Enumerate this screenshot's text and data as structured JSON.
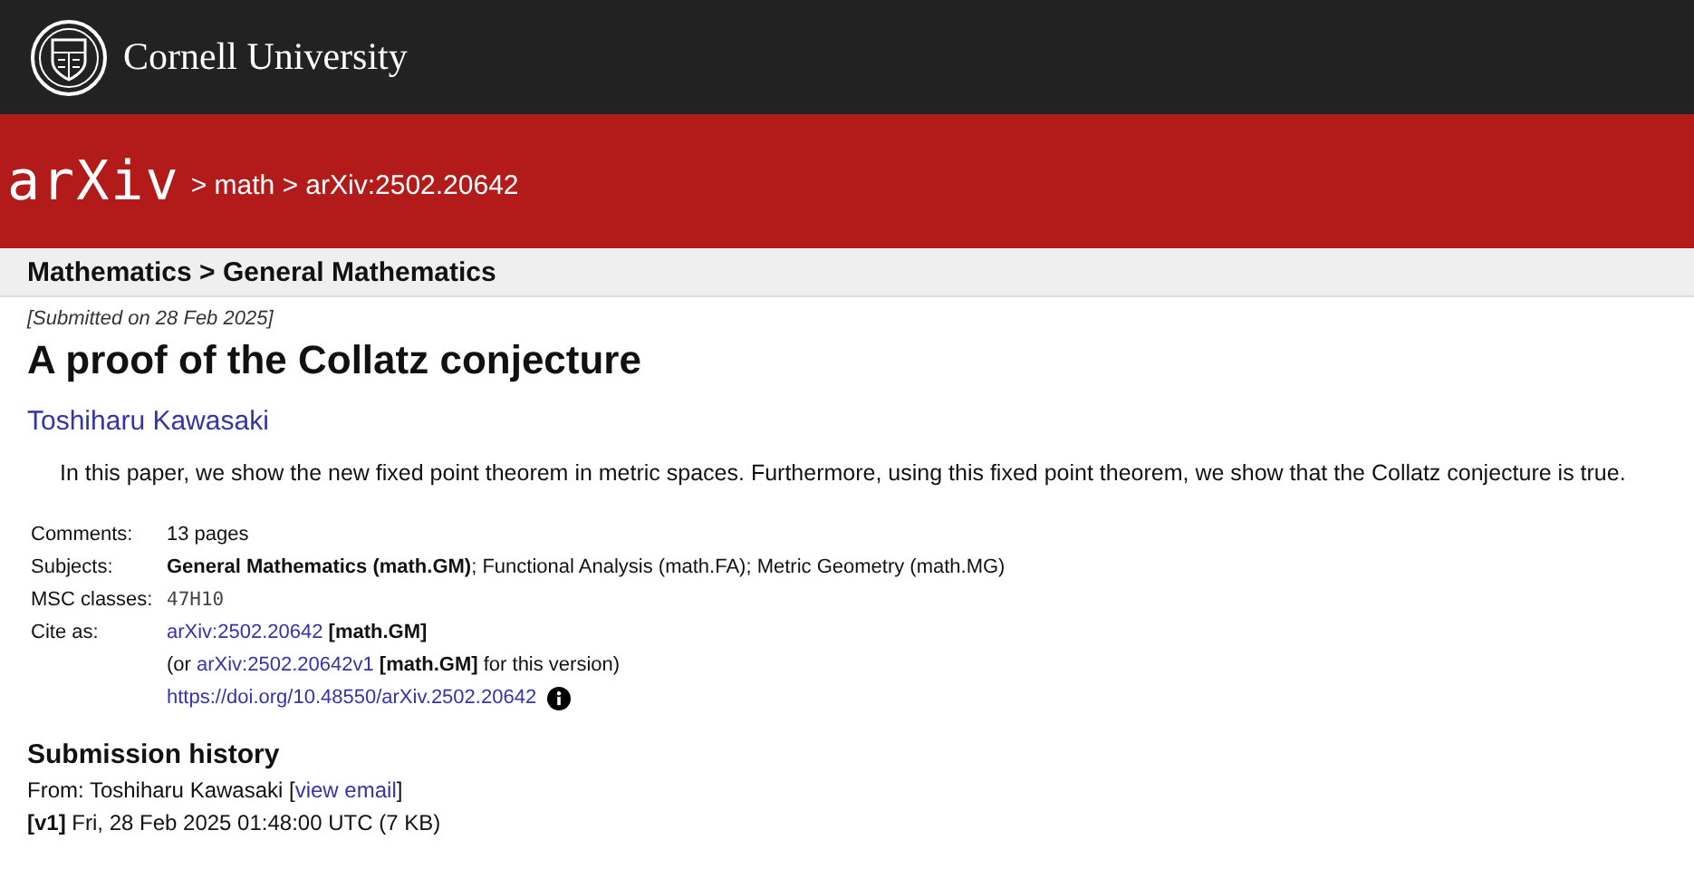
{
  "institution": {
    "name": "Cornell University"
  },
  "header": {
    "logo": "arXiv",
    "breadcrumb": "> math > arXiv:2502.20642"
  },
  "category_bar": {
    "title": "Mathematics > General Mathematics"
  },
  "paper": {
    "submitted": "[Submitted on 28 Feb 2025]",
    "title": "A proof of the Collatz conjecture",
    "authors": [
      "Toshiharu Kawasaki"
    ],
    "abstract": "In this paper, we show the new fixed point theorem in metric spaces. Furthermore, using this fixed point theorem, we show that the Collatz conjecture is true."
  },
  "metadata": [
    {
      "label": "Comments:",
      "kind": "text",
      "value": "13 pages"
    },
    {
      "label": "Subjects:",
      "kind": "text",
      "value": "**General Mathematics (math.GM)**; Functional Analysis (math.FA); Metric Geometry (math.MG)"
    },
    {
      "label": "MSC classes:",
      "kind": "mono",
      "value": "47H10"
    },
    {
      "label": "Cite as:",
      "kind": "cite",
      "lines": [
        {
          "link": "arXiv:2502.20642",
          "after": " **[math.GM]**"
        },
        {
          "before": "(or ",
          "link": "arXiv:2502.20642v1",
          "after": " **[math.GM]** for this version)"
        },
        {
          "link": "https://doi.org/10.48550/arXiv.2502.20642",
          "info": true
        }
      ]
    }
  ],
  "submission_history": {
    "title": "Submission history",
    "from_label": "From: Toshiharu Kawasaki [",
    "from_link": "view email",
    "from_end": "]",
    "versions": [
      {
        "version": "[v1]",
        "text": "Fri, 28 Feb 2025 01:48:00 UTC (7 KB)"
      }
    ]
  }
}
